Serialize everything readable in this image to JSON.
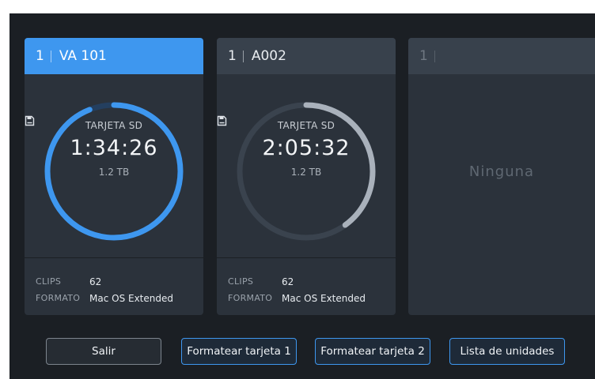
{
  "cards": [
    {
      "slot": "1",
      "name": "VA 101",
      "media": "TARJETA SD",
      "remaining": "1:34:26",
      "capacity": "1.2 TB",
      "fill_fraction": 0.94,
      "ring_color": "#3e97ef",
      "clips_label": "CLIPS",
      "clips_value": "62",
      "format_label": "FORMATO",
      "format_value": "Mac OS Extended"
    },
    {
      "slot": "1",
      "name": "A002",
      "media": "TARJETA SD",
      "remaining": "2:05:32",
      "capacity": "1.2 TB",
      "fill_fraction": 0.4,
      "ring_color": "#a9b1bb",
      "clips_label": "CLIPS",
      "clips_value": "62",
      "format_label": "FORMATO",
      "format_value": "Mac OS Extended"
    },
    {
      "slot": "1",
      "status": "Ninguna"
    }
  ],
  "buttons": {
    "exit": "Salir",
    "format_1": "Formatear tarjeta 1",
    "format_2": "Formatear tarjeta 2",
    "drive_list": "Lista de unidades"
  },
  "colors": {
    "accent": "#3e97ef",
    "background": "#1b1f24",
    "card": "#2b323b"
  }
}
